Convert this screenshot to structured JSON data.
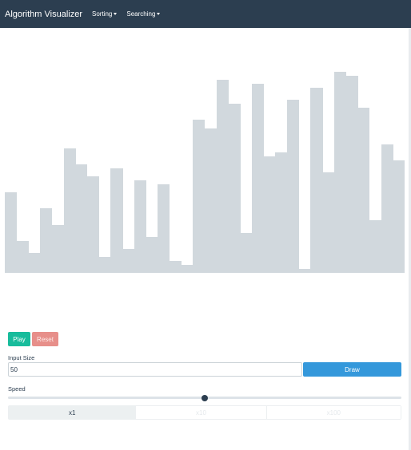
{
  "navbar": {
    "brand": "Algorithm Visualizer",
    "menus": [
      {
        "label": "Sorting"
      },
      {
        "label": "Searching"
      }
    ]
  },
  "chart_data": {
    "type": "bar",
    "bar_color": "#d1d8dd",
    "values": [
      100,
      40,
      25,
      80,
      60,
      155,
      135,
      120,
      20,
      130,
      30,
      115,
      45,
      110,
      15,
      10,
      190,
      180,
      240,
      210,
      50,
      235,
      145,
      150,
      215,
      5,
      230,
      125,
      250,
      245,
      205,
      65,
      160,
      140
    ]
  },
  "controls": {
    "play_label": "Play",
    "reset_label": "Reset",
    "input_size_label": "Input Size",
    "input_size_value": "50",
    "draw_label": "Draw",
    "speed_label": "Speed",
    "speed_value": 0.5,
    "speed_options": [
      "x1",
      "x10",
      "x100"
    ],
    "speed_active": 0
  },
  "colors": {
    "navbar": "#2c3e50",
    "play": "#18bc9c",
    "reset": "#e78f8a",
    "draw": "#3498db"
  }
}
